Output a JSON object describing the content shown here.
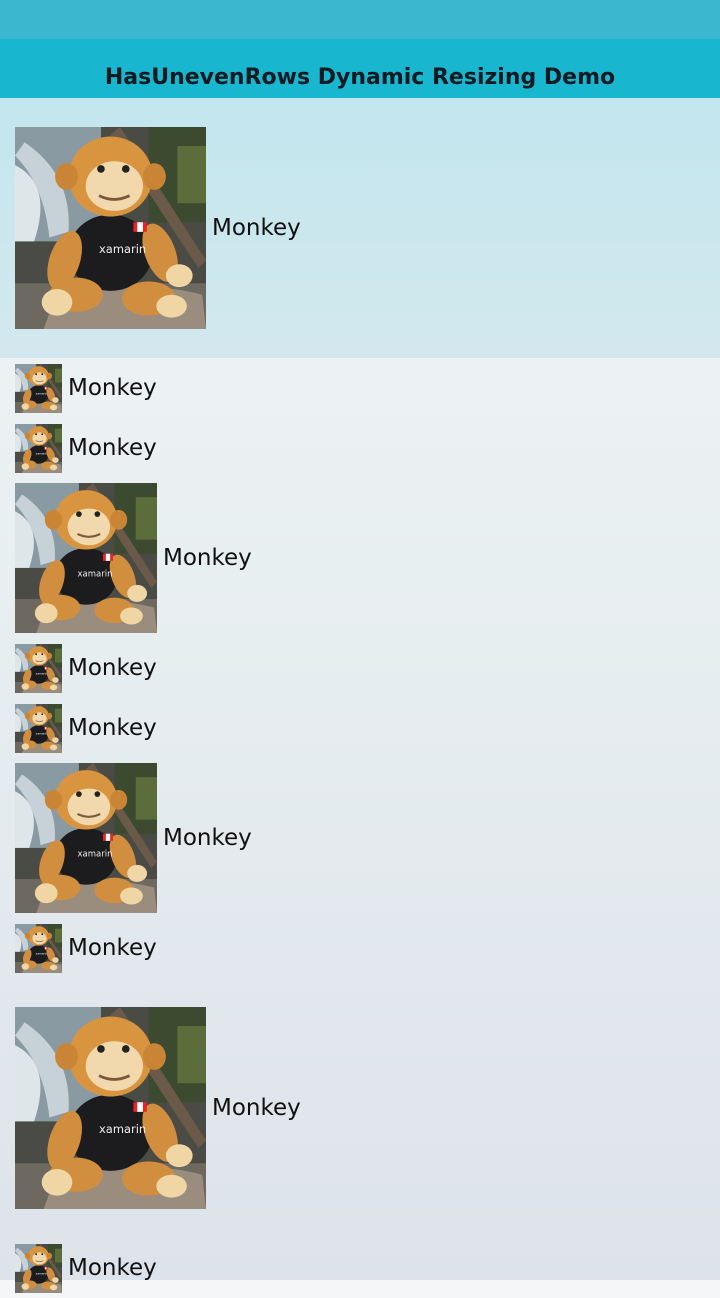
{
  "header": {
    "title": "HasUnevenRows Dynamic Resizing Demo"
  },
  "list": {
    "items": [
      {
        "label": "Monkey",
        "size": "large",
        "selected": true
      },
      {
        "label": "Monkey",
        "size": "small"
      },
      {
        "label": "Monkey",
        "size": "small"
      },
      {
        "label": "Monkey",
        "size": "medium"
      },
      {
        "label": "Monkey",
        "size": "small"
      },
      {
        "label": "Monkey",
        "size": "small"
      },
      {
        "label": "Monkey",
        "size": "medium"
      },
      {
        "label": "Monkey",
        "size": "small"
      },
      {
        "label": "Monkey",
        "size": "large"
      },
      {
        "label": "Monkey",
        "size": "small"
      }
    ]
  },
  "colors": {
    "status_bar": "#3bb7d0",
    "title_bar": "#19b6cf",
    "selected_row": "#c3e6ee"
  },
  "icons": {
    "thumbnail": "monkey-photo-icon"
  }
}
